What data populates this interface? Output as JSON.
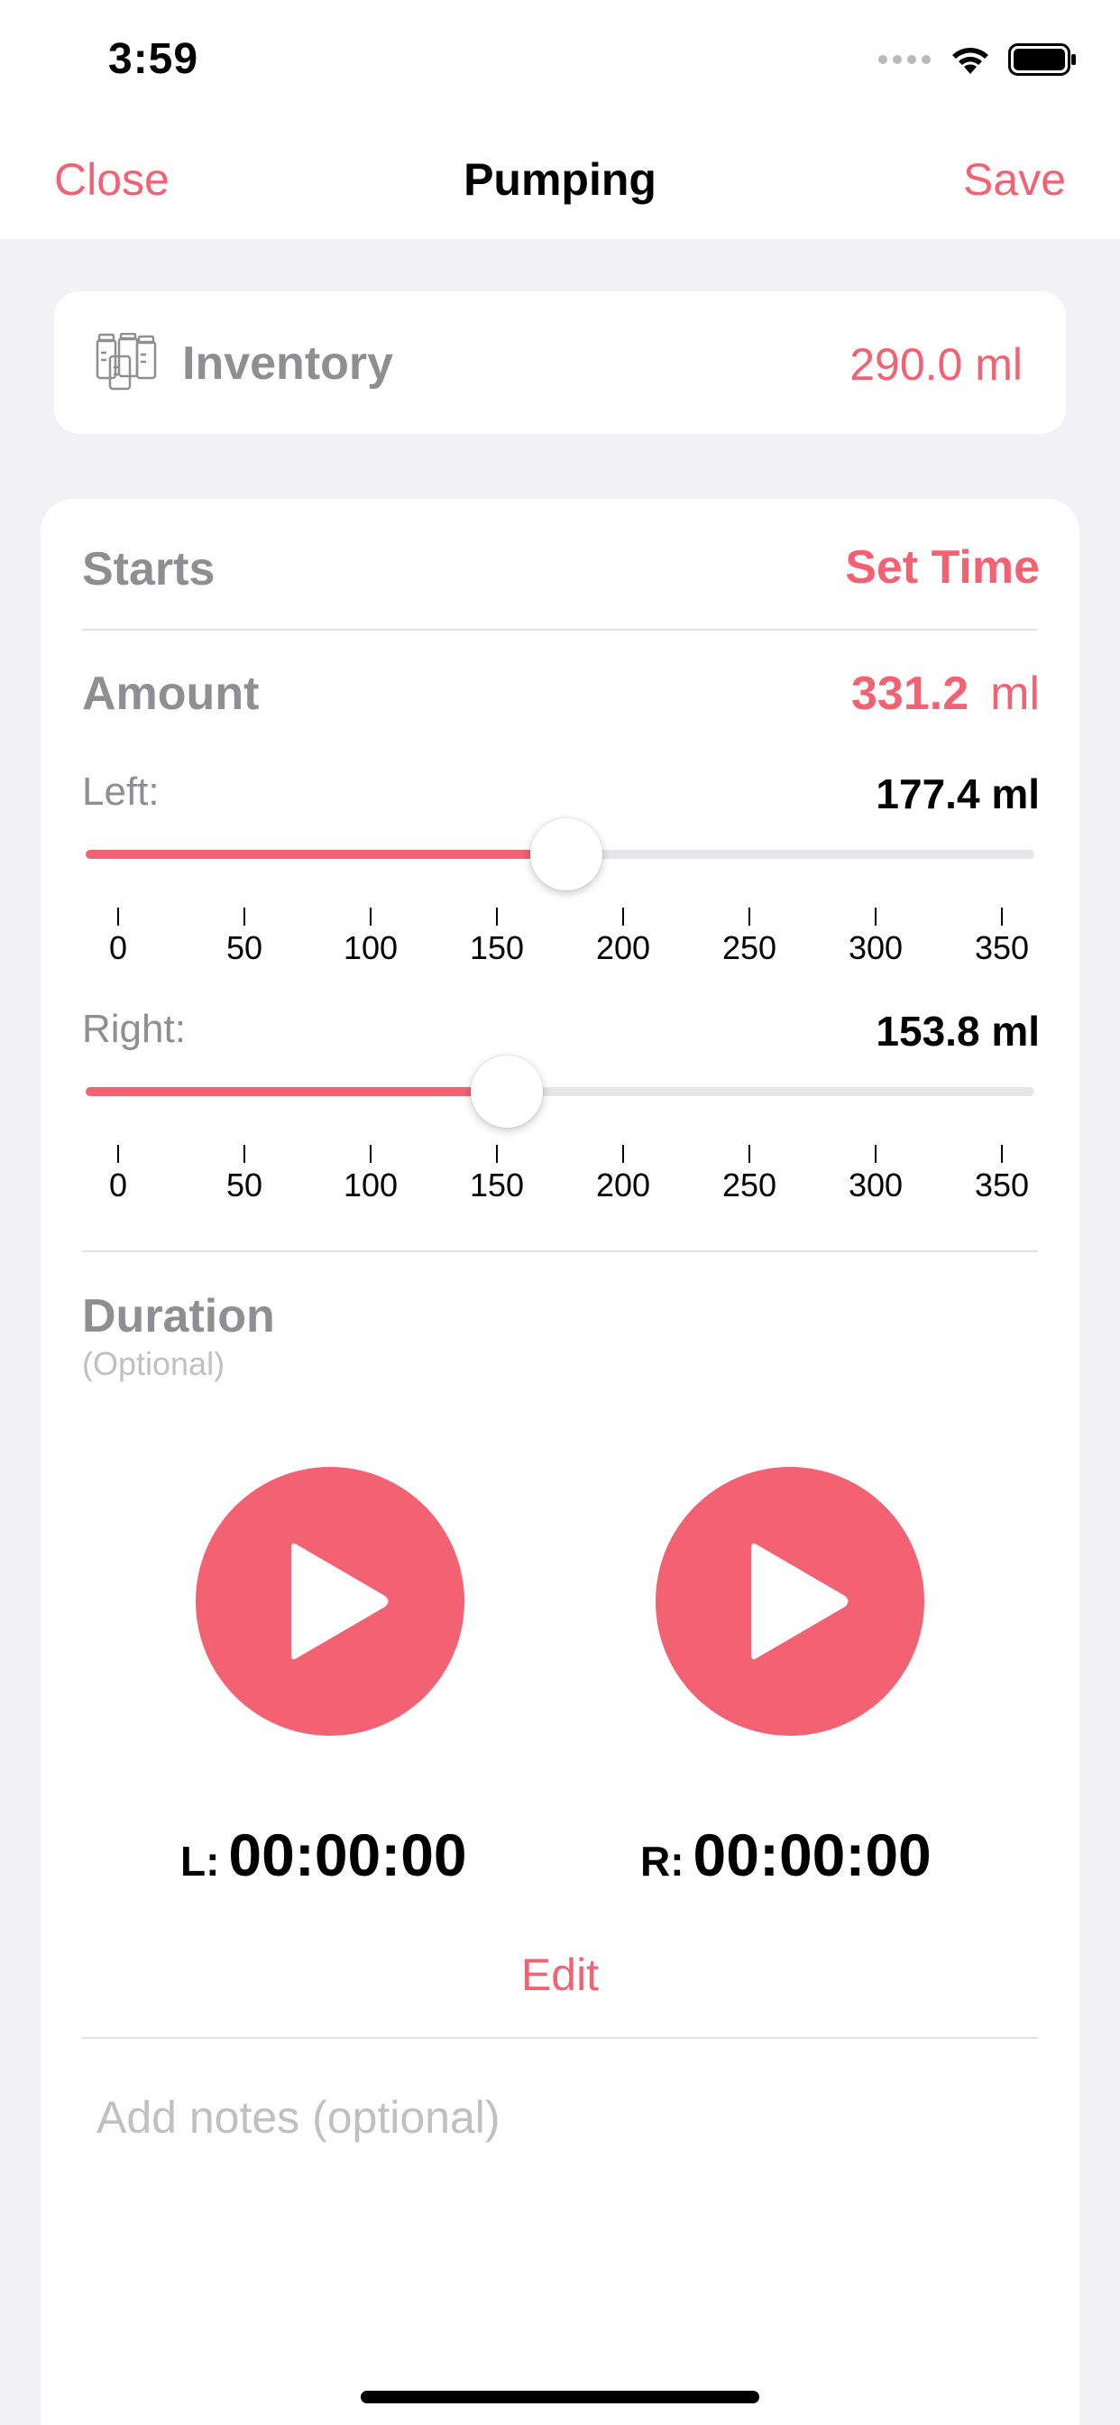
{
  "status_bar": {
    "time": "3:59"
  },
  "nav": {
    "close_label": "Close",
    "title": "Pumping",
    "save_label": "Save"
  },
  "inventory": {
    "label": "Inventory",
    "value": "290.0 ml",
    "icon": "bottles-icon"
  },
  "starts": {
    "label": "Starts",
    "action_label": "Set Time"
  },
  "amount": {
    "label": "Amount",
    "value": "331.2",
    "unit": "ml"
  },
  "left": {
    "label": "Left:",
    "value": "177.4 ml",
    "amount": 177.4
  },
  "right": {
    "label": "Right:",
    "value": "153.8 ml",
    "amount": 153.8
  },
  "slider_scale": {
    "min": 0,
    "max": 350,
    "ticks": [
      "0",
      "50",
      "100",
      "150",
      "200",
      "250",
      "300",
      "350"
    ]
  },
  "duration": {
    "label": "Duration",
    "optional": "(Optional)",
    "left_prefix": "L:",
    "left_time": "00:00:00",
    "right_prefix": "R:",
    "right_time": "00:00:00",
    "edit_label": "Edit"
  },
  "notes": {
    "placeholder": "Add notes (optional)"
  },
  "colors": {
    "accent": "#f26272",
    "background": "#f1f1f6",
    "secondary_text": "#8e8e93"
  }
}
